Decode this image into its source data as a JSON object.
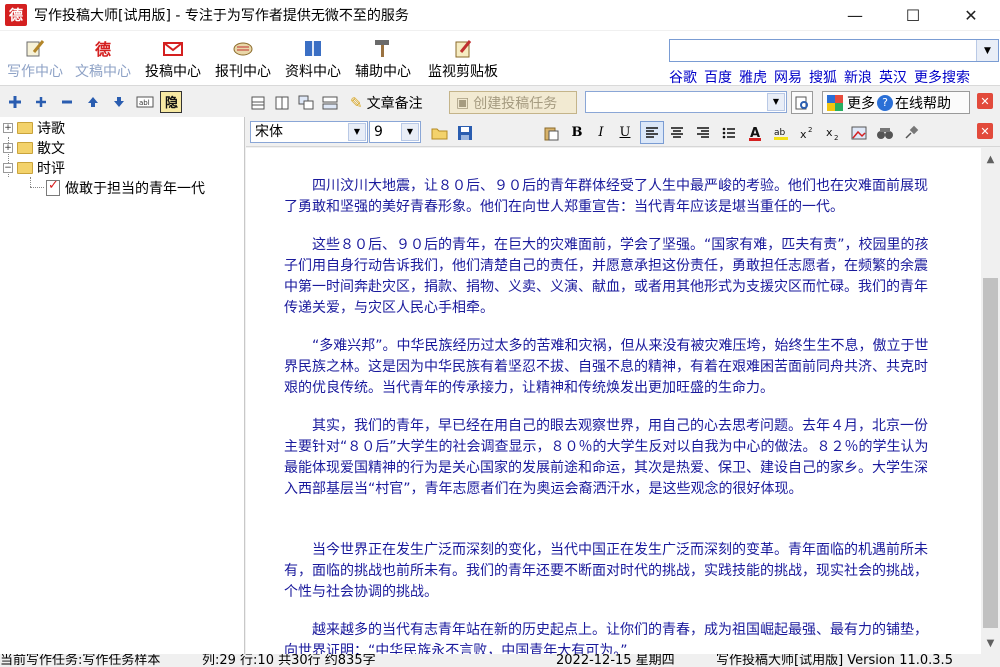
{
  "window": {
    "title": "写作投稿大师[试用版] - 专注于为写作者提供无微不至的服务",
    "app_icon_glyph": "德"
  },
  "main_toolbar": {
    "tools": [
      {
        "label": "写作中心",
        "icon": "pen-paper-icon",
        "enabled": false
      },
      {
        "label": "文稿中心",
        "icon": "manuscript-icon",
        "enabled": false
      },
      {
        "label": "投稿中心",
        "icon": "mail-icon",
        "enabled": true
      },
      {
        "label": "报刊中心",
        "icon": "newspaper-icon",
        "enabled": true
      },
      {
        "label": "资料中心",
        "icon": "book-icon",
        "enabled": true
      },
      {
        "label": "辅助中心",
        "icon": "hammer-icon",
        "enabled": true
      },
      {
        "label": "监视剪贴板",
        "icon": "clipboard-icon",
        "enabled": true
      }
    ],
    "search_value": "",
    "engines": [
      "谷歌",
      "百度",
      "雅虎",
      "网易",
      "搜狐",
      "新浪",
      "英汉",
      "更多搜索"
    ]
  },
  "tree_toolbar": {
    "icons": [
      "add-folder-icon",
      "add-item-icon",
      "remove-icon",
      "move-up-icon",
      "move-down-icon",
      "rename-icon",
      "hide-icon"
    ]
  },
  "tree": {
    "nodes": [
      {
        "label": "诗歌",
        "type": "folder",
        "expander": "+"
      },
      {
        "label": "散文",
        "type": "folder",
        "expander": "+"
      },
      {
        "label": "时评",
        "type": "folder",
        "expander": "−"
      },
      {
        "label": "做敢于担当的青年一代",
        "type": "document"
      }
    ]
  },
  "editor_toolbar": {
    "note_button": "文章备注",
    "create_task_button": "创建投稿任务",
    "task_combo_value": "",
    "online_help_button": "在线帮助",
    "more_button": "更多",
    "font_name": "宋体",
    "font_size": "9"
  },
  "document": {
    "paragraphs": [
      "四川汶川大地震，让８０后、９０后的青年群体经受了人生中最严峻的考验。他们也在灾难面前展现了勇敢和坚强的美好青春形象。他们在向世人郑重宣告：当代青年应该是堪当重任的一代。",
      "这些８０后、９０后的青年，在巨大的灾难面前，学会了坚强。“国家有难，匹夫有责”，校园里的孩子们用自身行动告诉我们，他们清楚自己的责任，并愿意承担这份责任，勇敢担任志愿者，在频繁的余震中第一时间奔赴灾区，捐款、捐物、义卖、义演、献血，或者用其他形式为支援灾区而忙碌。我们的青年传递关爱，与灾区人民心手相牵。",
      "“多难兴邦”。中华民族经历过太多的苦难和灾祸，但从来没有被灾难压垮，始终生生不息，傲立于世界民族之林。这是因为中华民族有着坚忍不拔、自强不息的精神，有着在艰难困苦面前同舟共济、共克时艰的优良传统。当代青年的传承接力，让精神和传统焕发出更加旺盛的生命力。",
      "其实，我们的青年，早已经在用自己的眼去观察世界，用自己的心去思考问题。去年４月，北京一份主要针对“８０后”大学生的社会调查显示，８０％的大学生反对以自我为中心的做法。８２％的学生认为最能体现爱国精神的行为是关心国家的发展前途和命运，其次是热爱、保卫、建设自己的家乡。大学生深入西部基层当“村官”，青年志愿者们在为奥运会裔洒汗水，是这些观念的很好体现。",
      "当今世界正在发生广泛而深刻的变化，当代中国正在发生广泛而深刻的变革。青年面临的机遇前所未有，面临的挑战也前所未有。我们的青年还要不断面对时代的挑战，实践技能的挑战，现实社会的挑战，个性与社会协调的挑战。",
      "越来越多的当代有志青年站在新的历史起点上。让你们的青春，成为祖国崛起最强、最有力的铺垫，向世界证明：“中华民族永不言败，中国青年大有可为。”"
    ]
  },
  "statusbar": {
    "task": "当前写作任务:写作任务样本",
    "position": "列:29 行:10 共30行 约835字",
    "date": "2022-12-15 星期四",
    "version": "写作投稿大师[试用版] Version 11.0.3.5"
  },
  "colors": {
    "text_blue": "#1a1a9c",
    "link_blue": "#0000c8",
    "disabled_label": "#8ea2c6"
  }
}
